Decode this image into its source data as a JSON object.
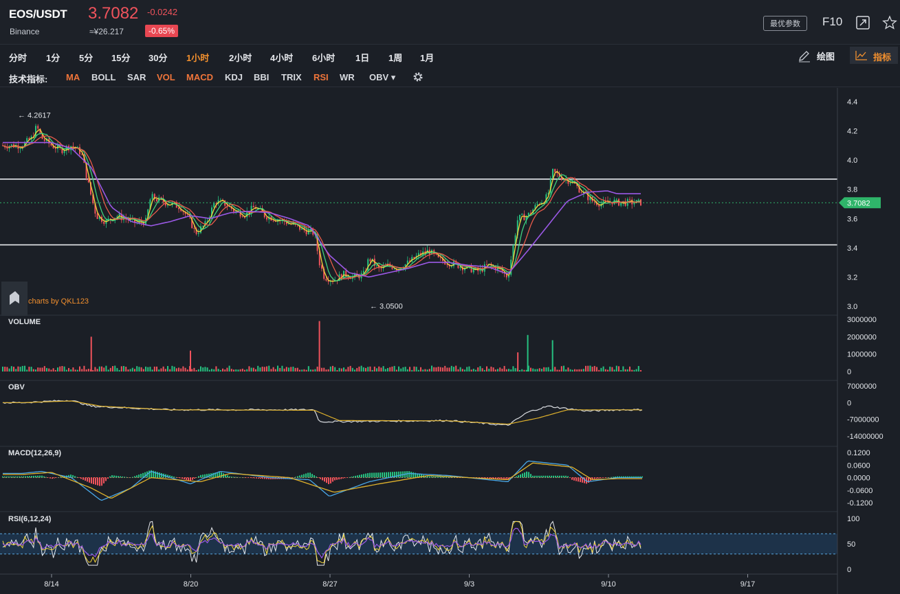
{
  "header": {
    "pair": "EOS/USDT",
    "exchange": "Binance",
    "price": "3.7082",
    "change": "-0.0242",
    "cny_price": "≈¥26.217",
    "change_pct": "-0.65%",
    "params_label": "最优参数",
    "f10_label": "F10",
    "expand_icon": "expand-icon",
    "star_icon": "star-icon"
  },
  "timeframes": [
    "分时",
    "1分",
    "5分",
    "15分",
    "30分",
    "1小时",
    "2小时",
    "4小时",
    "6小时",
    "1日",
    "1周",
    "1月"
  ],
  "active_timeframe": "1小时",
  "toolbar": {
    "draw_label": "绘图",
    "indicator_label": "指标"
  },
  "indicators": {
    "label": "技术指标:",
    "items": [
      {
        "name": "MA",
        "on": true
      },
      {
        "name": "BOLL",
        "on": false
      },
      {
        "name": "SAR",
        "on": false
      },
      {
        "name": "VOL",
        "on": true
      },
      {
        "name": "MACD",
        "on": true
      },
      {
        "name": "KDJ",
        "on": false
      },
      {
        "name": "BBI",
        "on": false
      },
      {
        "name": "TRIX",
        "on": false
      },
      {
        "name": "RSI",
        "on": true
      },
      {
        "name": "WR",
        "on": false
      },
      {
        "name": "OBV ▾",
        "on": false
      }
    ]
  },
  "watermark": "charts by QKL123",
  "colors": {
    "up": "#26c281",
    "down": "#f0535c",
    "ma5": "#f5d63b",
    "ma10": "#3fd27f",
    "ma20": "#e85b4a",
    "ma60": "#9b59e6",
    "accent": "#f3902e",
    "current": "#2fb56a"
  },
  "chart_data": [
    {
      "type": "candlestick",
      "panel": "price",
      "ylim": [
        3.0,
        4.4
      ],
      "y_ticks": [
        "4.4",
        "4.2",
        "4.0",
        "3.8",
        "3.6",
        "3.4",
        "3.2",
        "3.0"
      ],
      "x_ticks": [
        "8/14",
        "8/20",
        "8/27",
        "9/3",
        "9/10",
        "9/17"
      ],
      "high_label": "← 4.2617",
      "high_value": 4.2617,
      "low_label": "← 3.0500",
      "low_value": 3.05,
      "current_label": "3.7082",
      "current_value": 3.7082,
      "horizontal_lines": [
        3.87,
        3.42
      ],
      "close_path": [
        [
          "8/12 12:00",
          4.1
        ],
        [
          "8/13 00:00",
          4.15
        ],
        [
          "8/13 06:00",
          4.23
        ],
        [
          "8/13 12:00",
          4.15
        ],
        [
          "8/14 00:00",
          4.1
        ],
        [
          "8/14 12:00",
          4.07
        ],
        [
          "8/15 00:00",
          4.1
        ],
        [
          "8/15 12:00",
          4.05
        ],
        [
          "8/16 00:00",
          3.75
        ],
        [
          "8/16 06:00",
          3.62
        ],
        [
          "8/16 18:00",
          3.58
        ],
        [
          "8/17 06:00",
          3.62
        ],
        [
          "8/17 18:00",
          3.6
        ],
        [
          "8/18 06:00",
          3.57
        ],
        [
          "8/18 18:00",
          3.58
        ],
        [
          "8/19 00:00",
          3.75
        ],
        [
          "8/19 12:00",
          3.72
        ],
        [
          "8/20 00:00",
          3.7
        ],
        [
          "8/20 12:00",
          3.68
        ],
        [
          "8/21 00:00",
          3.58
        ],
        [
          "8/21 06:00",
          3.5
        ],
        [
          "8/21 18:00",
          3.56
        ],
        [
          "8/22 06:00",
          3.72
        ],
        [
          "8/22 18:00",
          3.7
        ],
        [
          "8/23 06:00",
          3.65
        ],
        [
          "8/23 18:00",
          3.63
        ],
        [
          "8/24 06:00",
          3.68
        ],
        [
          "8/24 18:00",
          3.62
        ],
        [
          "8/25 06:00",
          3.6
        ],
        [
          "8/25 18:00",
          3.58
        ],
        [
          "8/26 06:00",
          3.55
        ],
        [
          "8/26 18:00",
          3.52
        ],
        [
          "8/27 06:00",
          3.5
        ],
        [
          "8/27 12:00",
          3.3
        ],
        [
          "8/27 18:00",
          3.2
        ],
        [
          "8/28 06:00",
          3.18
        ],
        [
          "8/28 18:00",
          3.22
        ],
        [
          "8/29 06:00",
          3.2
        ],
        [
          "8/29 18:00",
          3.22
        ],
        [
          "8/30 00:00",
          3.33
        ],
        [
          "8/30 12:00",
          3.25
        ],
        [
          "8/31 00:00",
          3.28
        ],
        [
          "8/31 12:00",
          3.26
        ],
        [
          "9/1 00:00",
          3.3
        ],
        [
          "9/1 12:00",
          3.35
        ],
        [
          "9/2 00:00",
          3.38
        ],
        [
          "9/2 12:00",
          3.32
        ],
        [
          "9/3 00:00",
          3.3
        ],
        [
          "9/3 12:00",
          3.28
        ],
        [
          "9/4 00:00",
          3.26
        ],
        [
          "9/4 12:00",
          3.24
        ],
        [
          "9/5 00:00",
          3.28
        ],
        [
          "9/5 12:00",
          3.26
        ],
        [
          "9/6 00:00",
          3.2
        ],
        [
          "9/6 12:00",
          3.6
        ],
        [
          "9/7 00:00",
          3.62
        ],
        [
          "9/7 12:00",
          3.7
        ],
        [
          "9/8 00:00",
          3.75
        ],
        [
          "9/8 06:00",
          3.92
        ],
        [
          "9/8 18:00",
          3.88
        ],
        [
          "9/9 06:00",
          3.85
        ],
        [
          "9/9 18:00",
          3.78
        ],
        [
          "9/10 06:00",
          3.72
        ],
        [
          "9/10 18:00",
          3.7
        ],
        [
          "9/11 06:00",
          3.72
        ],
        [
          "9/11 12:00",
          3.71
        ]
      ],
      "ma60_path": [
        [
          "8/12 12:00",
          4.12
        ],
        [
          "8/14 00:00",
          4.12
        ],
        [
          "8/15 00:00",
          4.08
        ],
        [
          "8/16 00:00",
          3.95
        ],
        [
          "8/17 00:00",
          3.68
        ],
        [
          "8/18 00:00",
          3.58
        ],
        [
          "8/19 00:00",
          3.55
        ],
        [
          "8/20 00:00",
          3.58
        ],
        [
          "8/21 00:00",
          3.62
        ],
        [
          "8/22 00:00",
          3.6
        ],
        [
          "8/23 00:00",
          3.64
        ],
        [
          "8/24 00:00",
          3.65
        ],
        [
          "8/25 00:00",
          3.64
        ],
        [
          "8/26 00:00",
          3.6
        ],
        [
          "8/27 00:00",
          3.55
        ],
        [
          "8/28 00:00",
          3.35
        ],
        [
          "8/29 00:00",
          3.23
        ],
        [
          "8/30 00:00",
          3.2
        ],
        [
          "8/31 00:00",
          3.23
        ],
        [
          "9/1 00:00",
          3.26
        ],
        [
          "9/2 00:00",
          3.3
        ],
        [
          "9/3 00:00",
          3.3
        ],
        [
          "9/4 00:00",
          3.28
        ],
        [
          "9/5 00:00",
          3.27
        ],
        [
          "9/6 00:00",
          3.22
        ],
        [
          "9/7 00:00",
          3.38
        ],
        [
          "9/8 00:00",
          3.55
        ],
        [
          "9/9 00:00",
          3.72
        ],
        [
          "9/10 00:00",
          3.78
        ],
        [
          "9/11 00:00",
          3.79
        ],
        [
          "9/11 12:00",
          3.77
        ]
      ]
    },
    {
      "type": "bar",
      "panel": "volume",
      "title": "VOLUME",
      "y_ticks": [
        "3000000",
        "2000000",
        "1000000",
        "0"
      ],
      "ylim": [
        0,
        3000000
      ],
      "spikes": [
        {
          "x": "8/16 00:00",
          "value": 2000000,
          "dir": "down"
        },
        {
          "x": "8/21 00:00",
          "value": 1200000,
          "dir": "down"
        },
        {
          "x": "8/27 12:00",
          "value": 2900000,
          "dir": "down"
        },
        {
          "x": "9/6 12:00",
          "value": 1100000,
          "dir": "down"
        },
        {
          "x": "9/7 00:00",
          "value": 2100000,
          "dir": "up"
        },
        {
          "x": "9/8 06:00",
          "value": 1800000,
          "dir": "up"
        }
      ]
    },
    {
      "type": "line",
      "panel": "obv",
      "title": "OBV",
      "y_ticks": [
        "7000000",
        "0",
        "-7000000",
        "-14000000"
      ],
      "ylim": [
        -14000000,
        7000000
      ],
      "series": [
        {
          "name": "OBV",
          "color": "#d9dce0",
          "values": [
            [
              "8/12 12:00",
              0
            ],
            [
              "8/15 00:00",
              1000000
            ],
            [
              "8/16 00:00",
              -1500000
            ],
            [
              "8/20 00:00",
              -3000000
            ],
            [
              "8/27 06:00",
              -3000000
            ],
            [
              "8/27 12:00",
              -8000000
            ],
            [
              "9/3 00:00",
              -7500000
            ],
            [
              "9/6 00:00",
              -9500000
            ],
            [
              "9/7 00:00",
              -4000000
            ],
            [
              "9/8 00:00",
              -1500000
            ],
            [
              "9/10 00:00",
              -3500000
            ],
            [
              "9/11 12:00",
              -3000000
            ]
          ]
        },
        {
          "name": "MAOBV",
          "color": "#e0b22c",
          "values": [
            [
              "8/12 12:00",
              0
            ],
            [
              "8/15 00:00",
              700000
            ],
            [
              "8/16 12:00",
              -1500000
            ],
            [
              "8/20 00:00",
              -3000000
            ],
            [
              "8/27 06:00",
              -3200000
            ],
            [
              "8/28 12:00",
              -7500000
            ],
            [
              "9/3 00:00",
              -7600000
            ],
            [
              "9/6 00:00",
              -9000000
            ],
            [
              "9/7 12:00",
              -6500000
            ],
            [
              "9/9 00:00",
              -3000000
            ],
            [
              "9/11 12:00",
              -3000000
            ]
          ]
        }
      ]
    },
    {
      "type": "line",
      "panel": "macd",
      "title": "MACD(12,26,9)",
      "y_ticks": [
        "0.1200",
        "0.0600",
        "0.0000",
        "-0.0600",
        "-0.1200"
      ],
      "ylim": [
        -0.12,
        0.12
      ],
      "series": [
        {
          "name": "DIF",
          "color": "#4aa8e8",
          "values": [
            [
              "8/12 12:00",
              0.02
            ],
            [
              "8/13 12:00",
              0.03
            ],
            [
              "8/15 00:00",
              0.0
            ],
            [
              "8/16 12:00",
              -0.11
            ],
            [
              "8/18 00:00",
              -0.05
            ],
            [
              "8/19 00:00",
              0.03
            ],
            [
              "8/21 00:00",
              -0.03
            ],
            [
              "8/22 12:00",
              0.03
            ],
            [
              "8/25 00:00",
              0.0
            ],
            [
              "8/27 00:00",
              -0.01
            ],
            [
              "8/28 00:00",
              -0.09
            ],
            [
              "8/30 00:00",
              -0.02
            ],
            [
              "9/1 00:00",
              0.02
            ],
            [
              "9/3 00:00",
              0.01
            ],
            [
              "9/6 00:00",
              -0.02
            ],
            [
              "9/7 00:00",
              0.08
            ],
            [
              "9/8 00:00",
              0.07
            ],
            [
              "9/9 00:00",
              0.06
            ],
            [
              "9/10 00:00",
              -0.02
            ],
            [
              "9/11 12:00",
              0.0
            ]
          ]
        },
        {
          "name": "DEA",
          "color": "#e0b22c",
          "values": [
            [
              "8/12 12:00",
              0.015
            ],
            [
              "8/14 00:00",
              0.025
            ],
            [
              "8/16 00:00",
              -0.05
            ],
            [
              "8/17 00:00",
              -0.1
            ],
            [
              "8/19 00:00",
              0.0
            ],
            [
              "8/21 12:00",
              -0.02
            ],
            [
              "8/23 00:00",
              0.02
            ],
            [
              "8/26 00:00",
              0.0
            ],
            [
              "8/28 06:00",
              -0.07
            ],
            [
              "8/30 12:00",
              -0.03
            ],
            [
              "9/2 00:00",
              0.01
            ],
            [
              "9/6 00:00",
              -0.01
            ],
            [
              "9/7 06:00",
              0.07
            ],
            [
              "9/9 06:00",
              0.05
            ],
            [
              "9/10 06:00",
              -0.01
            ],
            [
              "9/11 12:00",
              -0.005
            ]
          ]
        }
      ]
    },
    {
      "type": "line",
      "panel": "rsi",
      "title": "RSI(6,12,24)",
      "y_ticks": [
        "100",
        "50",
        "0"
      ],
      "ylim": [
        0,
        100
      ],
      "bands": [
        70,
        30
      ]
    }
  ]
}
